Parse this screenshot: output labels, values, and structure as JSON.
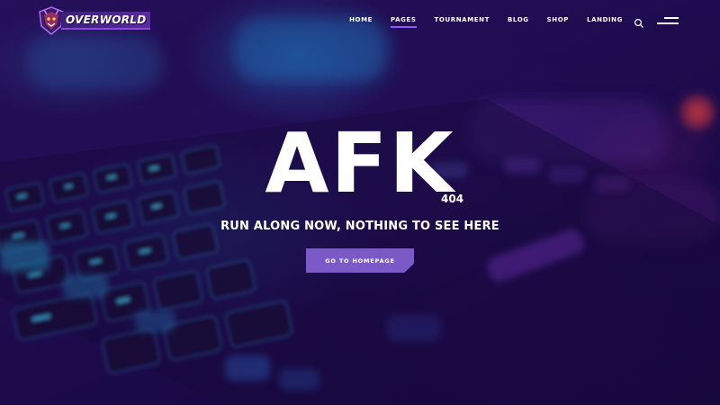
{
  "brand": {
    "logo_text": "OVERWORLD",
    "colors": {
      "accent": "#8f5cf0",
      "button": "#7b59c6",
      "background": "#1c0a45"
    }
  },
  "nav": {
    "items": [
      {
        "label": "HOME",
        "active": false
      },
      {
        "label": "PAGES",
        "active": true
      },
      {
        "label": "TOURNAMENT",
        "active": false
      },
      {
        "label": "BLOG",
        "active": false
      },
      {
        "label": "SHOP",
        "active": false
      },
      {
        "label": "LANDING",
        "active": false
      }
    ],
    "search_icon": "search-icon",
    "menu_icon": "hamburger-menu-icon"
  },
  "hero": {
    "title": "AFK",
    "code": "404",
    "subtitle": "RUN ALONG NOW, NOTHING TO SEE HERE",
    "button_label": "GO TO HOMEPAGE"
  }
}
